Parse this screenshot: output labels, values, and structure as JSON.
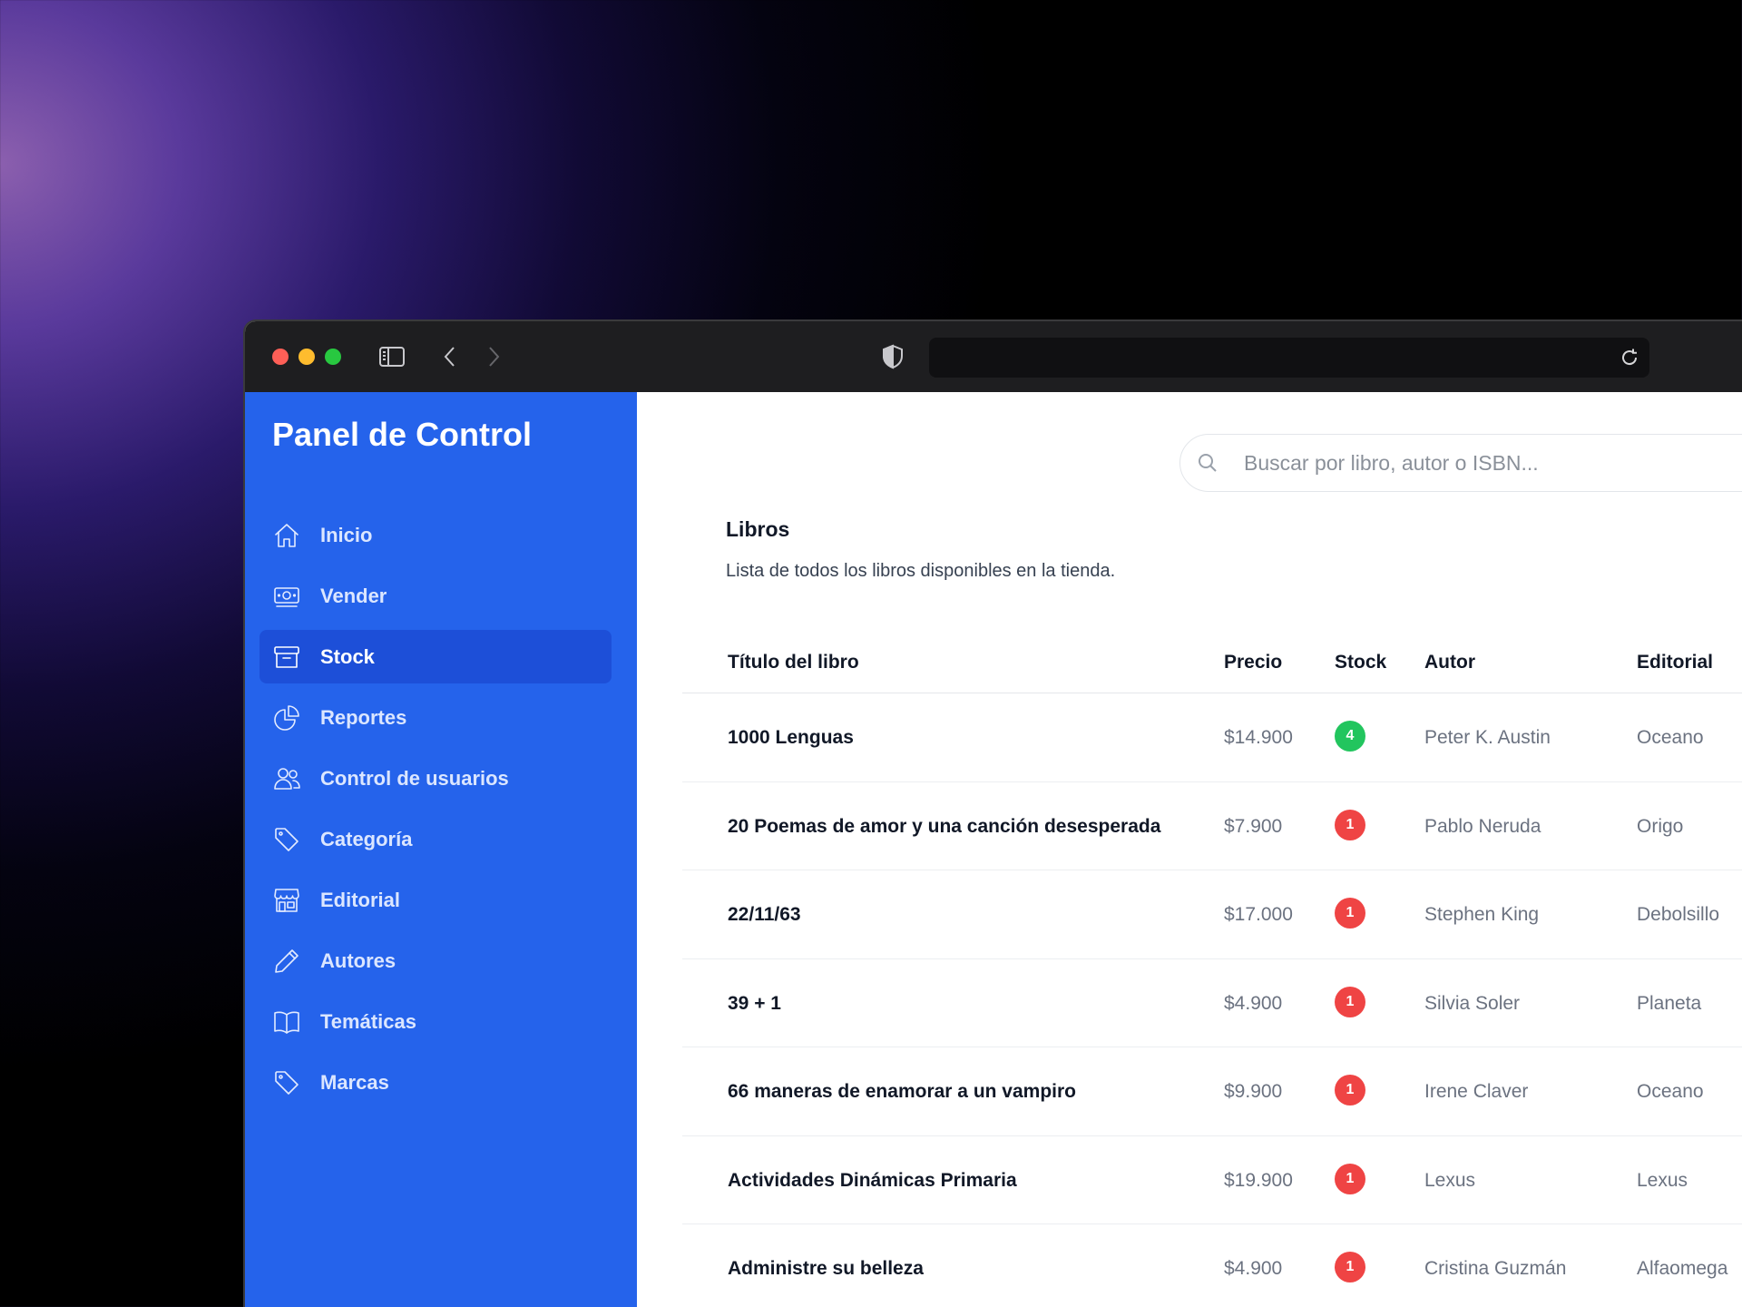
{
  "sidebar": {
    "brand": "Panel de Control",
    "items": [
      {
        "label": "Inicio",
        "icon": "home-icon"
      },
      {
        "label": "Vender",
        "icon": "money-icon"
      },
      {
        "label": "Stock",
        "icon": "archive-box-icon",
        "active": true
      },
      {
        "label": "Reportes",
        "icon": "pie-chart-icon"
      },
      {
        "label": "Control de usuarios",
        "icon": "users-icon"
      },
      {
        "label": "Categoría",
        "icon": "tag-icon"
      },
      {
        "label": "Editorial",
        "icon": "storefront-icon"
      },
      {
        "label": "Autores",
        "icon": "pencil-icon"
      },
      {
        "label": "Temáticas",
        "icon": "book-open-icon"
      },
      {
        "label": "Marcas",
        "icon": "tag-icon"
      }
    ]
  },
  "search": {
    "placeholder": "Buscar por libro, autor o ISBN..."
  },
  "section": {
    "title": "Libros",
    "subtitle": "Lista de todos los libros disponibles en la tienda."
  },
  "table": {
    "headers": {
      "title": "Título del libro",
      "price": "Precio",
      "stock": "Stock",
      "author": "Autor",
      "publisher": "Editorial"
    },
    "rows": [
      {
        "title": "1000 Lenguas",
        "price": "$14.900",
        "stock": "4",
        "author": "Peter K. Austin",
        "publisher": "Oceano"
      },
      {
        "title": "20 Poemas de amor y una canción desesperada",
        "price": "$7.900",
        "stock": "1",
        "author": "Pablo Neruda",
        "publisher": "Origo"
      },
      {
        "title": "22/11/63",
        "price": "$17.000",
        "stock": "1",
        "author": "Stephen King",
        "publisher": "Debolsillo"
      },
      {
        "title": "39 + 1",
        "price": "$4.900",
        "stock": "1",
        "author": "Silvia Soler",
        "publisher": "Planeta"
      },
      {
        "title": "66 maneras de enamorar a un vampiro",
        "price": "$9.900",
        "stock": "1",
        "author": "Irene Claver",
        "publisher": "Oceano"
      },
      {
        "title": "Actividades Dinámicas Primaria",
        "price": "$19.900",
        "stock": "1",
        "author": "Lexus",
        "publisher": "Lexus"
      },
      {
        "title": "Administre su belleza",
        "price": "$4.900",
        "stock": "1",
        "author": "Cristina Guzmán",
        "publisher": "Alfaomega"
      }
    ]
  },
  "colors": {
    "sidebar": "#2563eb",
    "sidebar_active": "#1d4fd8",
    "stock_ok": "#22c55e",
    "stock_low": "#ef4444"
  }
}
